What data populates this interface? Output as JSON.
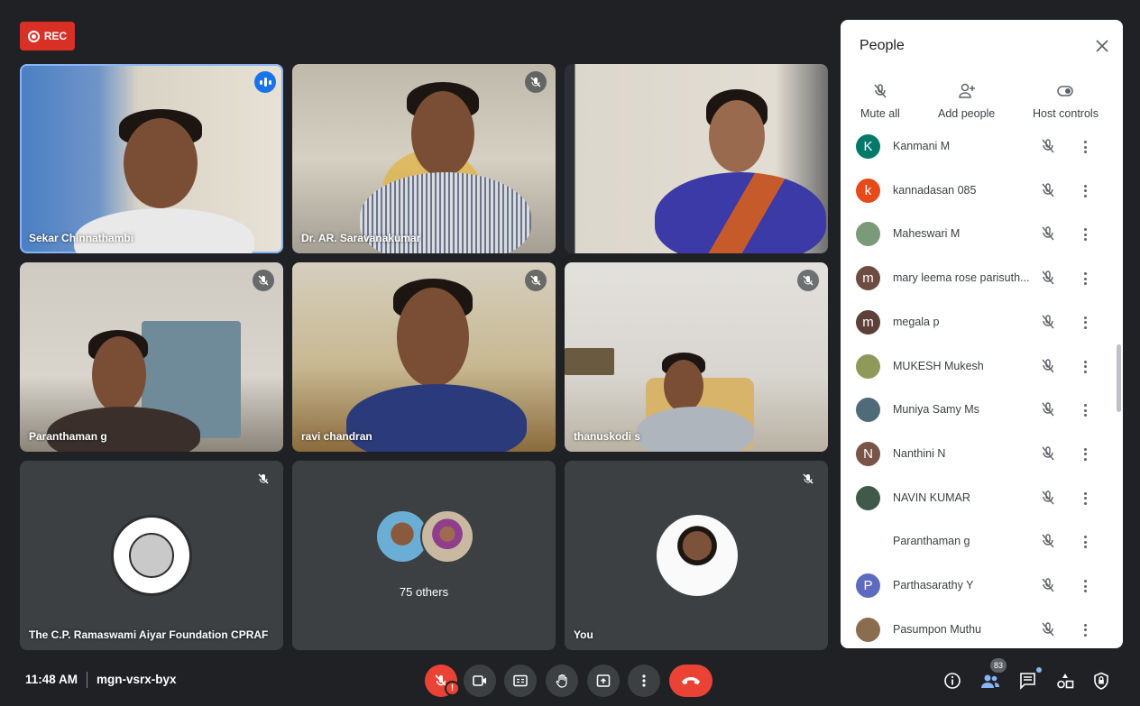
{
  "recording": {
    "label": "REC"
  },
  "tiles": [
    {
      "name": "Sekar Chinnathambi"
    },
    {
      "name": "Dr. AR. Saravanakumar"
    },
    {
      "name": ""
    },
    {
      "name": "Paranthaman g"
    },
    {
      "name": "ravi chandran"
    },
    {
      "name": "thanuskodi s"
    },
    {
      "name": "The C.P. Ramaswami Aiyar Foundation CPRAF"
    },
    {
      "name": ""
    },
    {
      "name": "You"
    }
  ],
  "others": {
    "label": "75 others"
  },
  "people_panel": {
    "title": "People",
    "actions": {
      "mute_all": "Mute all",
      "add_people": "Add people",
      "host_controls": "Host controls"
    },
    "participants": [
      {
        "name": "Kanmani M",
        "initial": "K",
        "color": "#00796b"
      },
      {
        "name": "kannadasan 085",
        "initial": "k",
        "color": "#e64a19"
      },
      {
        "name": "Maheswari M",
        "initial": "",
        "color": "#7a9a7a"
      },
      {
        "name": "mary leema rose parisuth...",
        "initial": "m",
        "color": "#6d4c41"
      },
      {
        "name": "megala p",
        "initial": "m",
        "color": "#5d4037"
      },
      {
        "name": "MUKESH Mukesh",
        "initial": "",
        "color": "#8d9a5a"
      },
      {
        "name": "Muniya Samy Ms",
        "initial": "",
        "color": "#4f6b78"
      },
      {
        "name": "Nanthini N",
        "initial": "N",
        "color": "#795548"
      },
      {
        "name": "NAVIN KUMAR",
        "initial": "",
        "color": "#3f5a4a"
      },
      {
        "name": "Paranthaman g",
        "initial": "",
        "color": "#ffffff"
      },
      {
        "name": "Parthasarathy Y",
        "initial": "P",
        "color": "#5c6bc0"
      },
      {
        "name": "Pasumpon Muthu",
        "initial": "",
        "color": "#8a6d4e"
      }
    ]
  },
  "bottom_bar": {
    "time": "11:48 AM",
    "meeting_code": "mgn-vsrx-byx",
    "participant_count": "83",
    "mic_alert": "!"
  }
}
